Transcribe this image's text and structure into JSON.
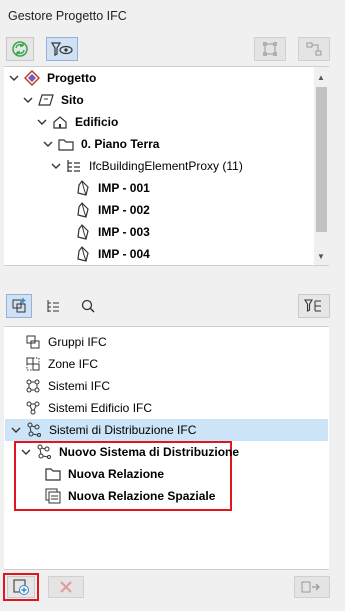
{
  "window": {
    "title": "Gestore Progetto IFC"
  },
  "toolbar_top": {
    "refresh_icon": "refresh-icon",
    "filter_view_icon": "filter-view-icon"
  },
  "tree": [
    {
      "label": "Progetto",
      "bold": true,
      "icon": "project-icon",
      "expanded": true
    },
    {
      "label": "Sito",
      "bold": true,
      "icon": "site-icon",
      "expanded": true
    },
    {
      "label": "Edificio",
      "bold": true,
      "icon": "building-icon",
      "expanded": true
    },
    {
      "label": "0. Piano Terra",
      "bold": true,
      "icon": "storey-icon",
      "expanded": true
    },
    {
      "label": "IfcBuildingElementProxy (11)",
      "bold": false,
      "icon": "type-icon",
      "expanded": true
    },
    {
      "label": "IMP - 001",
      "bold": true,
      "icon": "element-icon"
    },
    {
      "label": "IMP - 002",
      "bold": true,
      "icon": "element-icon"
    },
    {
      "label": "IMP - 003",
      "bold": true,
      "icon": "element-icon"
    },
    {
      "label": "IMP - 004",
      "bold": true,
      "icon": "element-icon"
    }
  ],
  "lower_list": [
    {
      "label": "Gruppi IFC",
      "icon": "group-icon"
    },
    {
      "label": "Zone IFC",
      "icon": "zone-icon"
    },
    {
      "label": "Sistemi IFC",
      "icon": "system-icon"
    },
    {
      "label": "Sistemi Edificio IFC",
      "icon": "building-system-icon"
    },
    {
      "label": "Sistemi di Distribuzione IFC",
      "icon": "distribution-system-icon",
      "selected": true,
      "expanded": true
    }
  ],
  "highlighted": [
    {
      "label": "Nuovo Sistema di Distribuzione",
      "icon": "distribution-system-icon",
      "expanded": true
    },
    {
      "label": "Nuova Relazione",
      "icon": "folder-icon"
    },
    {
      "label": "Nuova Relazione Spaziale",
      "icon": "spatial-relation-icon"
    }
  ],
  "colors": {
    "highlight_border": "#e0161e",
    "selection": "#cce4f7",
    "accent_green": "#3aa64a",
    "accent_red": "#d94b4b"
  }
}
